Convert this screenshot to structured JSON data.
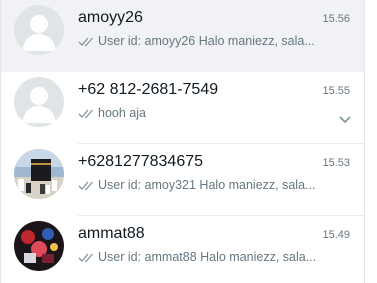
{
  "chats": [
    {
      "name": "amoyy26",
      "time": "15.56",
      "preview": "User id: amoyy26 Halo maniezz, sala...",
      "avatar": "default-avatar-icon",
      "active": true
    },
    {
      "name": "+62 812-2681-7549",
      "time": "15.55",
      "preview": "hooh  aja",
      "avatar": "default-avatar-icon",
      "active": false
    },
    {
      "name": "+6281277834675",
      "time": "15.53",
      "preview": "User id: amoy321 Halo maniezz, sala...",
      "avatar": "kaaba-photo",
      "active": false
    },
    {
      "name": "ammat88",
      "time": "15.49",
      "preview": "User id: ammat88 Halo maniezz, sala...",
      "avatar": "colorful-photo",
      "active": false
    }
  ],
  "colors": {
    "active_row": "#f0f2f5",
    "name": "#111b21",
    "secondary": "#667781",
    "ticks": "#8696a0",
    "divider": "#e9edef"
  }
}
